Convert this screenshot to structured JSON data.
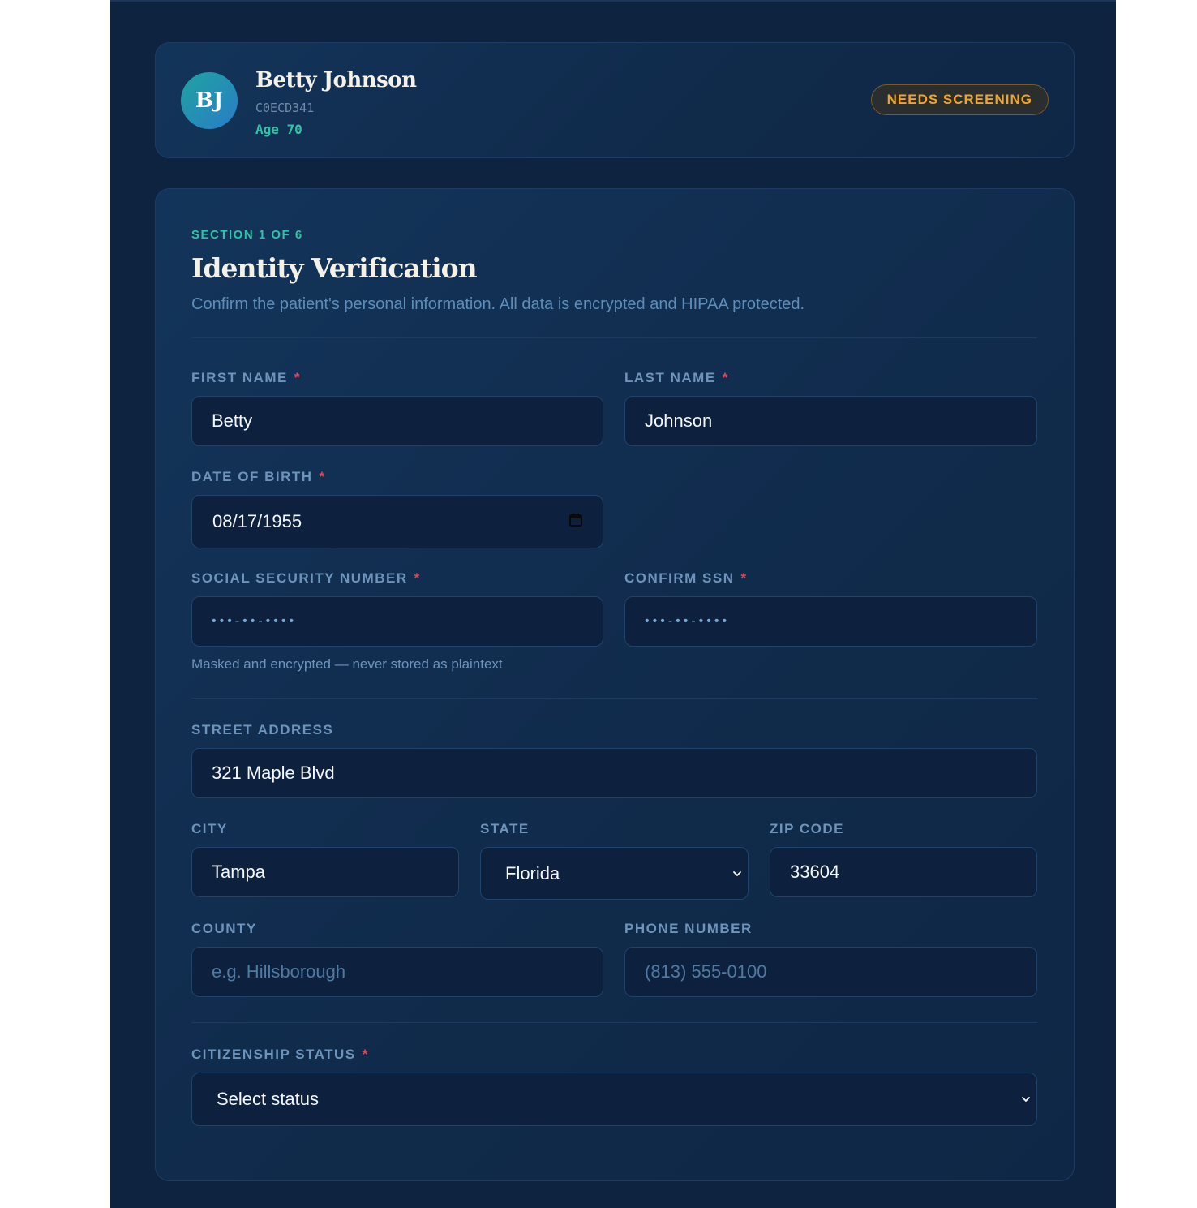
{
  "patient": {
    "initials": "BJ",
    "name": "Betty Johnson",
    "id": "C0ECD341",
    "age_label": "Age 70",
    "status_badge": "NEEDS SCREENING"
  },
  "section": {
    "tag": "SECTION 1 OF 6",
    "title": "Identity Verification",
    "description": "Confirm the patient's personal information. All data is encrypted and HIPAA protected."
  },
  "form": {
    "first_name": {
      "label": "FIRST NAME",
      "required": "*",
      "value": "Betty"
    },
    "last_name": {
      "label": "LAST NAME",
      "required": "*",
      "value": "Johnson"
    },
    "dob": {
      "label": "DATE OF BIRTH",
      "required": "*",
      "value": "08/17/1955"
    },
    "ssn": {
      "label": "SOCIAL SECURITY NUMBER",
      "required": "*",
      "value": "•••-••-••••",
      "help": "Masked and encrypted — never stored as plaintext"
    },
    "confirm_ssn": {
      "label": "CONFIRM SSN",
      "required": "*",
      "value": "•••-••-••••"
    },
    "street": {
      "label": "STREET ADDRESS",
      "value": "321 Maple Blvd"
    },
    "city": {
      "label": "CITY",
      "value": "Tampa"
    },
    "state": {
      "label": "STATE",
      "value": "Florida"
    },
    "zip": {
      "label": "ZIP CODE",
      "value": "33604"
    },
    "county": {
      "label": "COUNTY",
      "placeholder": "e.g. Hillsborough"
    },
    "phone": {
      "label": "PHONE NUMBER",
      "placeholder": "(813) 555-0100"
    },
    "citizenship": {
      "label": "CITIZENSHIP STATUS",
      "required": "*",
      "value": "Select status"
    }
  },
  "icons": {
    "calendar": "calendar-icon",
    "chevron": "chevron-down-icon"
  },
  "colors": {
    "background": "#0e2340",
    "accent_teal": "#2ec4a4",
    "badge_amber": "#f2a424",
    "required_red": "#e0455a"
  }
}
